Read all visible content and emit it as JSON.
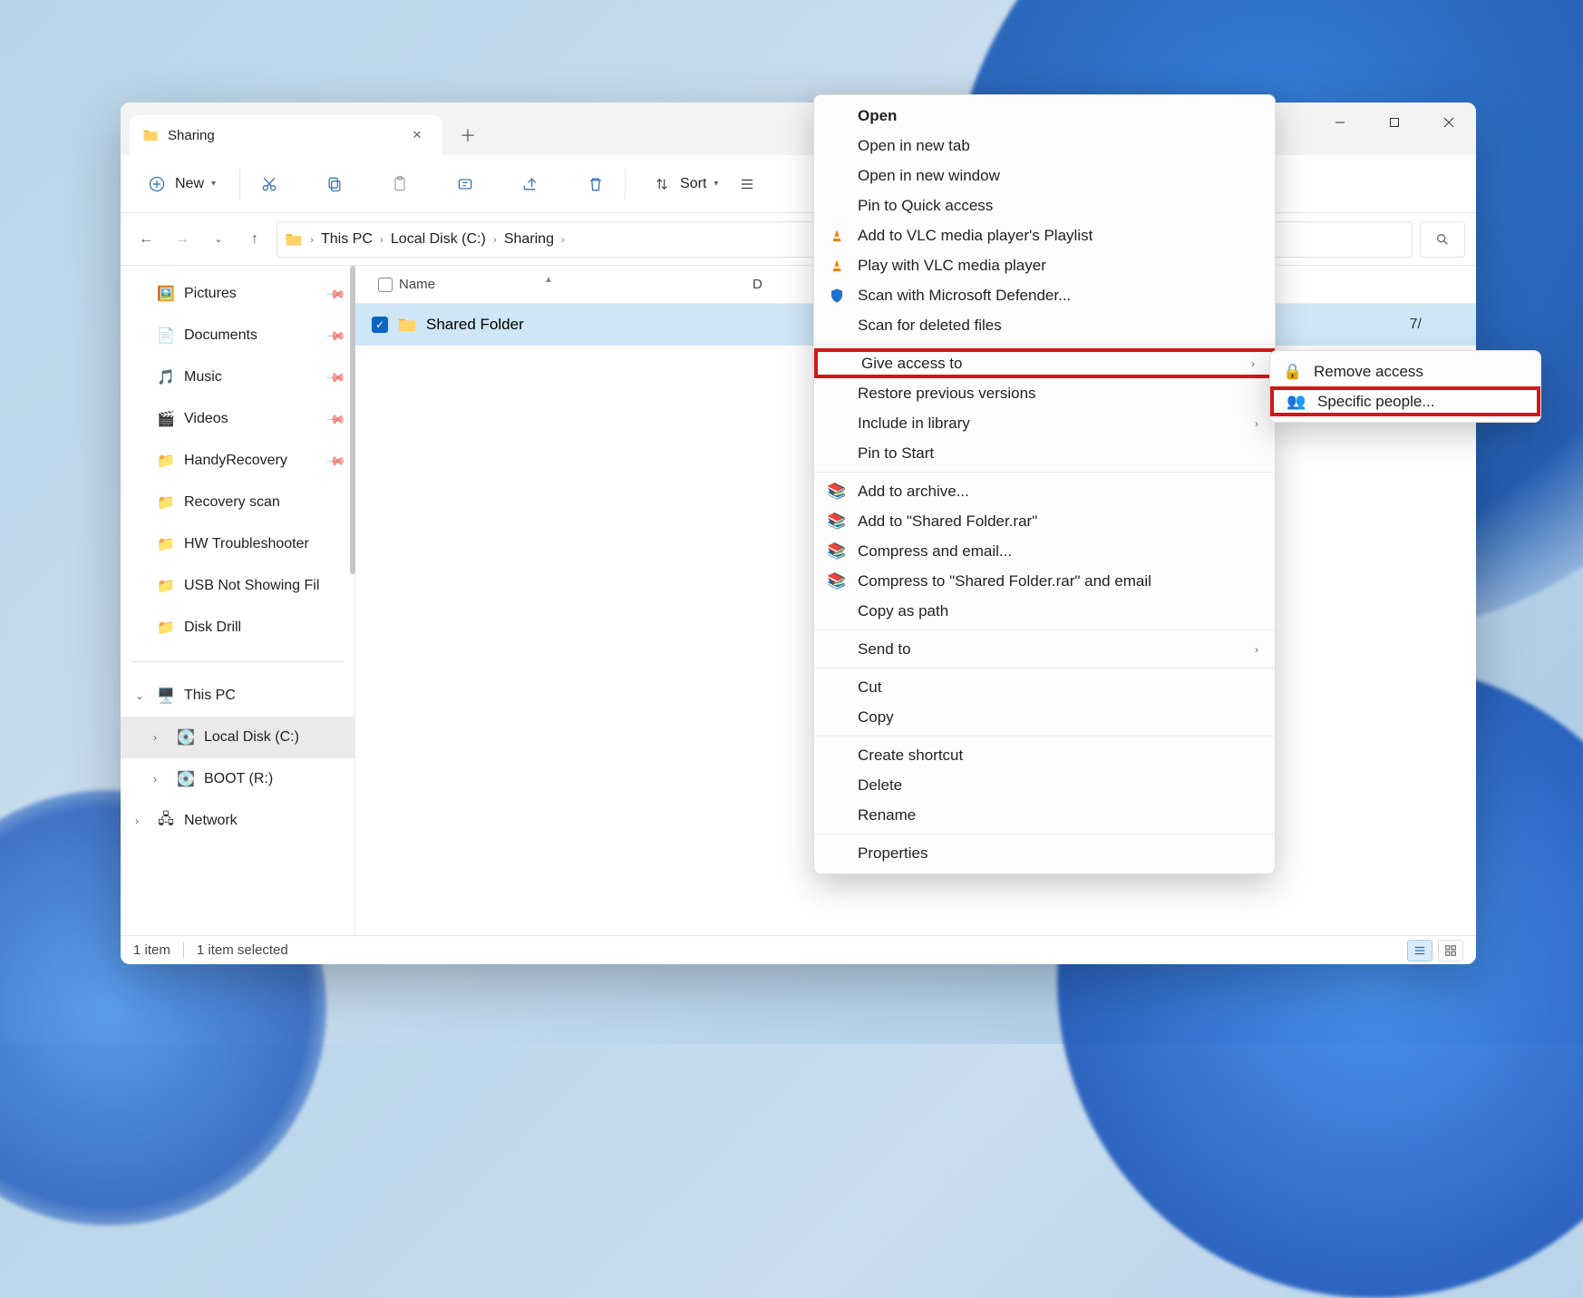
{
  "tab": {
    "title": "Sharing"
  },
  "toolbar": {
    "new": "New",
    "sort": "Sort"
  },
  "breadcrumb": {
    "a": "This PC",
    "b": "Local Disk (C:)",
    "c": "Sharing"
  },
  "columns": {
    "name": "Name",
    "date": "D"
  },
  "row": {
    "name": "Shared Folder",
    "date": "7/"
  },
  "sidebar": {
    "pictures": "Pictures",
    "documents": "Documents",
    "music": "Music",
    "videos": "Videos",
    "handy": "HandyRecovery",
    "recovery": "Recovery scan",
    "hw": "HW Troubleshooter",
    "usb": "USB Not Showing Fil",
    "diskdrill": "Disk Drill",
    "thispc": "This PC",
    "localc": "Local Disk (C:)",
    "boot": "BOOT (R:)",
    "network": "Network"
  },
  "status": {
    "items": "1 item",
    "selected": "1 item selected"
  },
  "menu": {
    "open": "Open",
    "opentab": "Open in new tab",
    "openwin": "Open in new window",
    "pinqa": "Pin to Quick access",
    "vlcadd": "Add to VLC media player's Playlist",
    "vlcplay": "Play with VLC media player",
    "defender": "Scan with Microsoft Defender...",
    "scandel": "Scan for deleted files",
    "access": "Give access to",
    "restore": "Restore previous versions",
    "library": "Include in library",
    "pinstart": "Pin to Start",
    "archive": "Add to archive...",
    "addrar": "Add to \"Shared Folder.rar\"",
    "compress": "Compress and email...",
    "compressrar": "Compress to \"Shared Folder.rar\" and email",
    "copypath": "Copy as path",
    "sendto": "Send to",
    "cut": "Cut",
    "copy": "Copy",
    "shortcut": "Create shortcut",
    "delete": "Delete",
    "rename": "Rename",
    "props": "Properties"
  },
  "submenu": {
    "remove": "Remove access",
    "specific": "Specific people..."
  }
}
